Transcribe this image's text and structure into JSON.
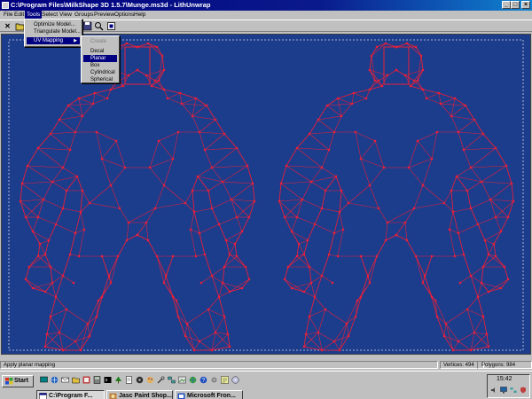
{
  "window": {
    "title": "C:\\Program Files\\MilkShape 3D 1.5.7\\Munge.ms3d - LithUnwrap",
    "minimize_label": "_",
    "maximize_label": "□",
    "close_label": "×"
  },
  "menubar": {
    "items": [
      {
        "label": "File"
      },
      {
        "label": "Edit"
      },
      {
        "label": "Tools"
      },
      {
        "label": "Select"
      },
      {
        "label": "View"
      },
      {
        "label": "Groups"
      },
      {
        "label": "Preview"
      },
      {
        "label": "Options"
      },
      {
        "label": "Help"
      }
    ]
  },
  "tools_menu": {
    "items": [
      {
        "label": "Optimize Model..."
      },
      {
        "label": "Triangulate Model..."
      },
      {
        "label": "UV Mapping",
        "submenu": true
      }
    ]
  },
  "uv_submenu": {
    "items": [
      {
        "label": "Create",
        "disabled": true
      },
      {
        "label": "Decal"
      },
      {
        "label": "Planar",
        "selected": true
      },
      {
        "label": "Box"
      },
      {
        "label": "Cylindrical"
      },
      {
        "label": "Spherical"
      }
    ]
  },
  "toolbar": {
    "icons": [
      "close-icon",
      "open-folder-icon",
      "save-icon",
      "pointer-icon",
      "zoom-icon",
      "fit-icon",
      "rotate-icon"
    ]
  },
  "statusbar": {
    "message": "Apply planar mapping",
    "vertices": "Vertices: 494",
    "polygons": "Polygons: 984"
  },
  "taskbar": {
    "start_label": "Start",
    "tasks": [
      {
        "label": "C:\\Program F...",
        "active": true
      },
      {
        "label": "Jasc Paint Shop..."
      },
      {
        "label": "Microsoft Fron..."
      }
    ],
    "clock": "15:42"
  },
  "colors": {
    "canvas_bg": "#1c3c8c",
    "mesh": "#e8203a",
    "title_bar": "#000080"
  }
}
